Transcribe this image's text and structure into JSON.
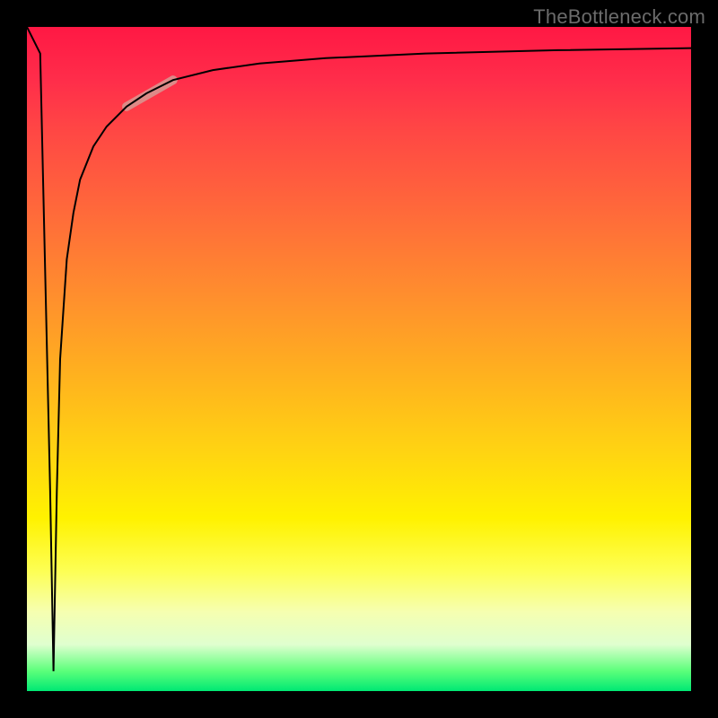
{
  "watermark": {
    "text": "TheBottleneck.com"
  },
  "chart_data": {
    "type": "line",
    "title": "",
    "xlabel": "",
    "ylabel": "",
    "xlim": [
      0,
      100
    ],
    "ylim": [
      0,
      100
    ],
    "grid": false,
    "legend": false,
    "annotations": [],
    "background_gradient": {
      "direction": "vertical",
      "stops": [
        {
          "pos": 0.0,
          "color": "#ff1844"
        },
        {
          "pos": 0.5,
          "color": "#ffb01f"
        },
        {
          "pos": 0.8,
          "color": "#fdff55"
        },
        {
          "pos": 1.0,
          "color": "#00e874"
        }
      ]
    },
    "series": [
      {
        "name": "bottleneck-curve",
        "color": "#000000",
        "stroke_width": 2,
        "x": [
          0.0,
          2.0,
          3.5,
          4.0,
          4.5,
          5.0,
          6.0,
          7.0,
          8.0,
          10.0,
          12.0,
          15.0,
          18.0,
          22.0,
          28.0,
          35.0,
          45.0,
          60.0,
          80.0,
          100.0
        ],
        "y": [
          100.0,
          96.0,
          30.0,
          3.0,
          30.0,
          50.0,
          65.0,
          72.0,
          77.0,
          82.0,
          85.0,
          88.0,
          90.0,
          92.0,
          93.5,
          94.5,
          95.3,
          96.0,
          96.5,
          96.8
        ]
      },
      {
        "name": "highlight-segment",
        "color": "#d79a93",
        "stroke_width": 10,
        "x": [
          15.0,
          22.0
        ],
        "y": [
          88.0,
          92.0
        ]
      }
    ]
  }
}
